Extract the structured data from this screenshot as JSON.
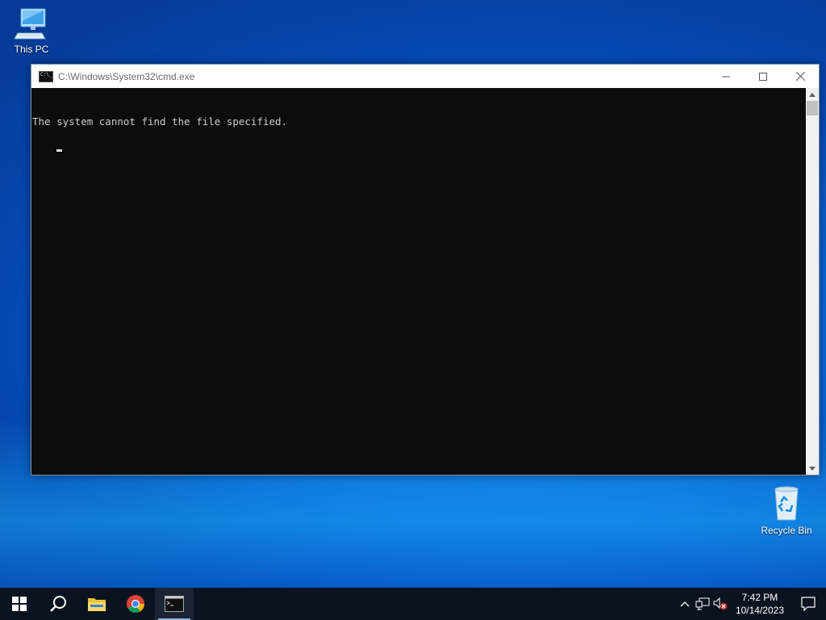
{
  "desktop": {
    "icons": [
      {
        "label": "This PC"
      },
      {
        "label": "Recycle Bin"
      }
    ]
  },
  "window": {
    "title": "C:\\Windows\\System32\\cmd.exe",
    "icon_text": "C:\\_",
    "console_lines": [
      "The system cannot find the file specified."
    ],
    "controls": {
      "minimize": "—",
      "maximize": "☐",
      "close": "✕"
    }
  },
  "taskbar": {
    "apps": [
      {
        "name": "start-icon"
      },
      {
        "name": "search-icon"
      },
      {
        "name": "file-explorer-icon"
      },
      {
        "name": "chrome-icon"
      },
      {
        "name": "cmd-icon"
      }
    ],
    "tray": {
      "chevron": "^",
      "time": "7:42 PM",
      "date": "10/14/2023"
    }
  }
}
